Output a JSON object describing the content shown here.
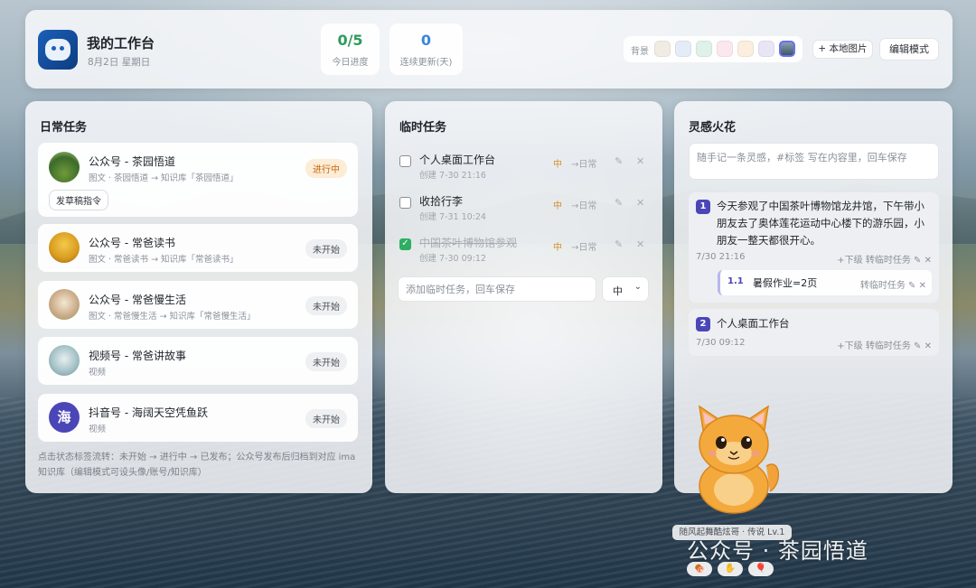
{
  "header": {
    "title": "我的工作台",
    "date": "8月2日 星期日",
    "stats": [
      {
        "value": "0/5",
        "label": "今日进度"
      },
      {
        "value": "0",
        "label": "连续更新(天)"
      }
    ],
    "bg_label": "背景",
    "swatches": [
      "#f1ece3",
      "#e4ecf8",
      "#dff2ea",
      "#fbe8ee",
      "#fbeede",
      "#e8e6f6",
      "image"
    ],
    "local_image_button": "+ 本地图片",
    "edit_button": "编辑模式"
  },
  "daily": {
    "title": "日常任务",
    "tasks": [
      {
        "name": "公众号 - 茶园悟道",
        "sub": "图文 · 茶园悟道 → 知识库「茶园悟道」",
        "status": "进行中",
        "chip": "发草稿指令"
      },
      {
        "name": "公众号 - 常爸读书",
        "sub": "图文 · 常爸读书 → 知识库「常爸读书」",
        "status": "未开始"
      },
      {
        "name": "公众号 - 常爸慢生活",
        "sub": "图文 · 常爸慢生活 → 知识库「常爸慢生活」",
        "status": "未开始"
      },
      {
        "name": "视频号 - 常爸讲故事",
        "sub": "视频",
        "status": "未开始"
      },
      {
        "name": "抖音号 - 海阔天空凭鱼跃",
        "sub": "视频",
        "status": "未开始",
        "avatar_char": "海"
      }
    ],
    "tip": "点击状态标签流转：未开始 → 进行中 → 已发布；公众号发布后归档到对应 ima 知识库（编辑模式可设头像/账号/知识库）"
  },
  "temp": {
    "title": "临时任务",
    "items": [
      {
        "name": "个人桌面工作台",
        "date": "创建 7-30 21:16",
        "priority": "中",
        "to_daily": "→日常",
        "done": false
      },
      {
        "name": "收拾行李",
        "date": "创建 7-31 10:24",
        "priority": "中",
        "to_daily": "→日常",
        "done": false
      },
      {
        "name": "中国茶叶博物馆参观",
        "date": "创建 7-30 09:12",
        "priority": "中",
        "to_daily": "→日常",
        "done": true
      }
    ],
    "input_placeholder": "添加临时任务，回车保存",
    "priority_select": "中"
  },
  "inspiration": {
    "title": "灵感火花",
    "input_placeholder": "随手记一条灵感，#标签 写在内容里，回车保存",
    "ideas": [
      {
        "index": "1",
        "text": "今天参观了中国茶叶博物馆龙井馆，下午带小朋友去了奥体莲花运动中心楼下的游乐园，小朋友一整天都很开心。",
        "date": "7/30 21:16",
        "actions": "+下级  转临时任务",
        "children": [
          {
            "index": "1.1",
            "text": "暑假作业=2页",
            "actions": "转临时任务"
          }
        ]
      },
      {
        "index": "2",
        "text": "个人桌面工作台",
        "date": "7/30 09:12",
        "actions": "+下级  转临时任务",
        "children": []
      }
    ]
  },
  "pet": {
    "label": "随风起舞酷炫哥 · 传说 Lv.1"
  },
  "watermark": "公众号 · 茶园悟道",
  "colors": {
    "accent": "#4b46b8",
    "progress_green": "#2e9b5a",
    "streak_blue": "#3c86d6",
    "doing_badge": "#fdecd6",
    "priority_orange": "#d3902a"
  }
}
